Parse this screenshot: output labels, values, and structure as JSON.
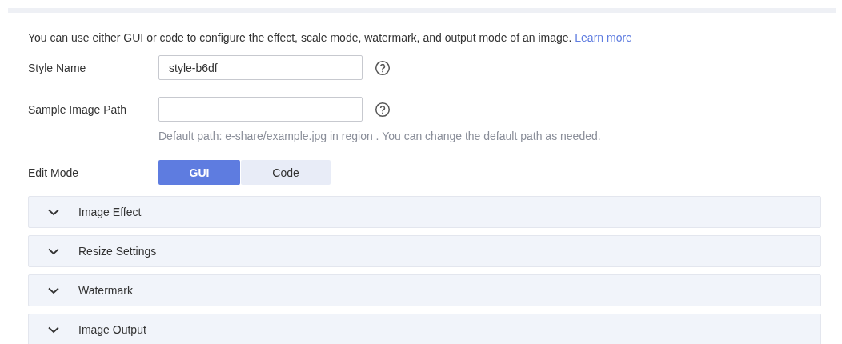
{
  "intro": {
    "text": "You can use either GUI or code to configure the effect, scale mode, watermark, and output mode of an image.",
    "link": "Learn more"
  },
  "fields": [
    {
      "label": "Style Name",
      "value": "style-b6df",
      "help": true
    },
    {
      "label": "Sample Image Path",
      "help": true,
      "hint": "Default path: e-share/example.jpg in region . You can change the default path as needed."
    }
  ],
  "edit_mode": {
    "label": "Edit Mode",
    "options": [
      {
        "label": "GUI",
        "selected": true
      },
      {
        "label": "Code",
        "selected": false
      }
    ]
  },
  "panels": [
    {
      "title": "Image Effect",
      "expanded": false
    },
    {
      "title": "Resize Settings",
      "expanded": false
    },
    {
      "title": "Watermark",
      "expanded": false
    },
    {
      "title": "Image Output",
      "expanded": false
    }
  ]
}
